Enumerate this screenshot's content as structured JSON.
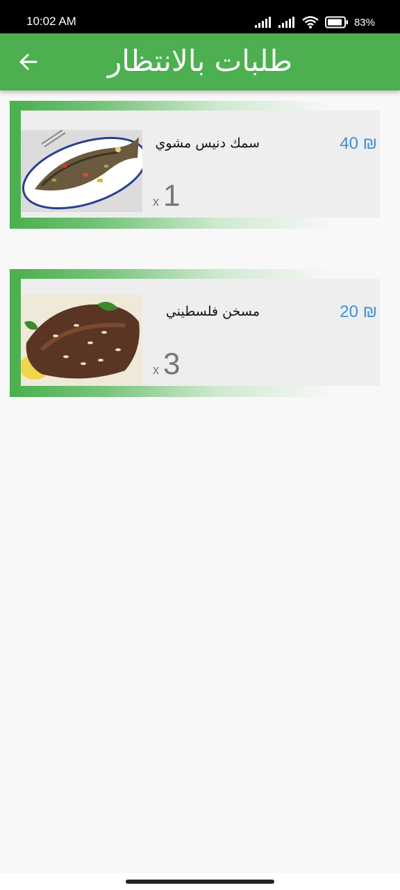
{
  "status_bar": {
    "time": "10:02 AM",
    "battery": "83%"
  },
  "app_bar": {
    "title": "طلبات بالانتظار",
    "back_icon": "arrow-left-icon"
  },
  "orders": [
    {
      "name": "سمك دنيس مشوي",
      "price": "40 ₪",
      "qty_prefix": "x",
      "qty": "1",
      "image": "grilled-fish-photo"
    },
    {
      "name": "مسخن فلسطيني",
      "price": "20 ₪",
      "qty_prefix": "x",
      "qty": "3",
      "image": "musakhan-chicken-photo"
    }
  ],
  "colors": {
    "primary": "#4cb050",
    "price": "#3f8fd7",
    "card_background": "#eeeeee"
  }
}
